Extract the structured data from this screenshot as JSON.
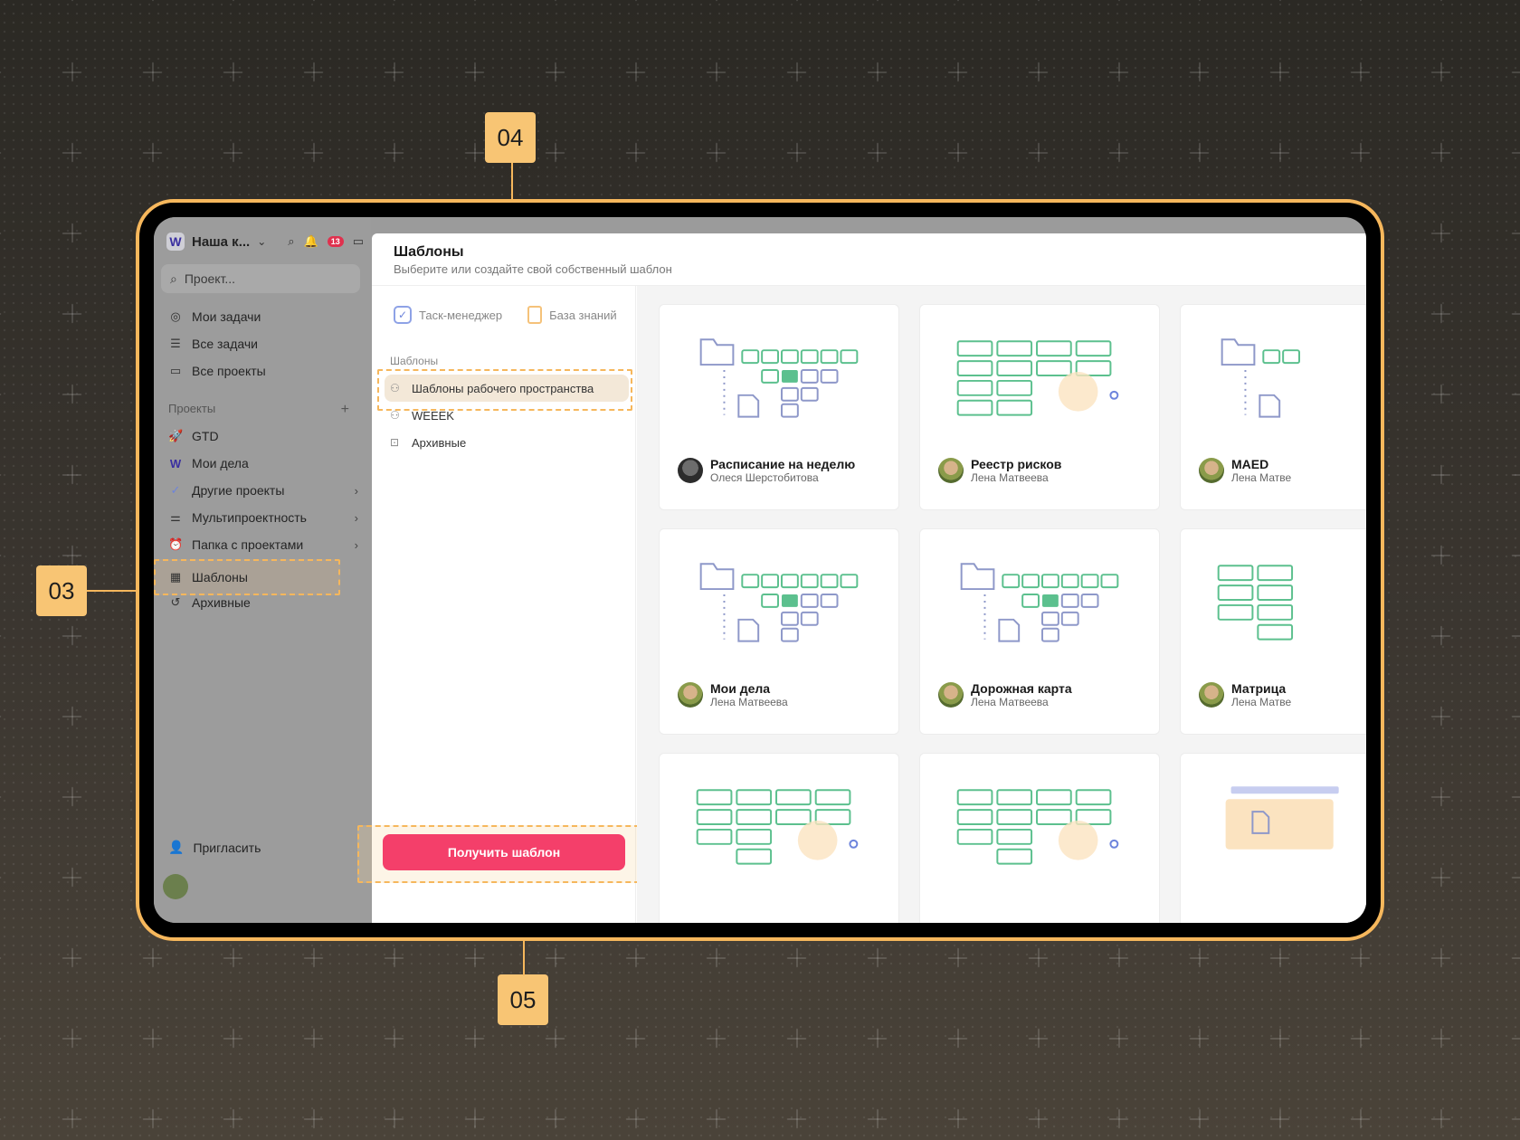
{
  "callouts": {
    "c03": "03",
    "c04": "04",
    "c05": "05"
  },
  "sidebar": {
    "workspace": "Наша к...",
    "notifications": "13",
    "search_placeholder": "Проект...",
    "nav": [
      {
        "label": "Мои задачи"
      },
      {
        "label": "Все задачи"
      },
      {
        "label": "Все проекты"
      }
    ],
    "projects_label": "Проекты",
    "projects": [
      {
        "label": "GTD"
      },
      {
        "label": "Мои дела"
      },
      {
        "label": "Другие проекты"
      },
      {
        "label": "Мультипроектность"
      },
      {
        "label": "Папка с проектами"
      }
    ],
    "templates": "Шаблоны",
    "archive": "Архивные",
    "invite": "Пригласить"
  },
  "modal": {
    "title": "Шаблоны",
    "subtitle": "Выберите или создайте свой собственный шаблон",
    "tabs": [
      {
        "label": "Таск-менеджер"
      },
      {
        "label": "База знаний"
      }
    ],
    "library_label": "Шаблоны",
    "library": [
      {
        "label": "Шаблоны рабочего пространства"
      },
      {
        "label": "WEEEK"
      },
      {
        "label": "Архивные"
      }
    ],
    "cta": "Получить шаблон"
  },
  "cards": [
    {
      "title": "Расписание на неделю",
      "author": "Олеся Шерстобитова"
    },
    {
      "title": "Реестр рисков",
      "author": "Лена Матвеева"
    },
    {
      "title": "MAED",
      "author": "Лена Матве"
    },
    {
      "title": "Мои дела",
      "author": "Лена Матвеева"
    },
    {
      "title": "Дорожная карта",
      "author": "Лена Матвеева"
    },
    {
      "title": "Матрица",
      "author": "Лена Матве"
    }
  ],
  "colors": {
    "accent": "#f6b75c",
    "cta": "#f43f6a",
    "green": "#5cc08e",
    "blue": "#6d84dc"
  }
}
